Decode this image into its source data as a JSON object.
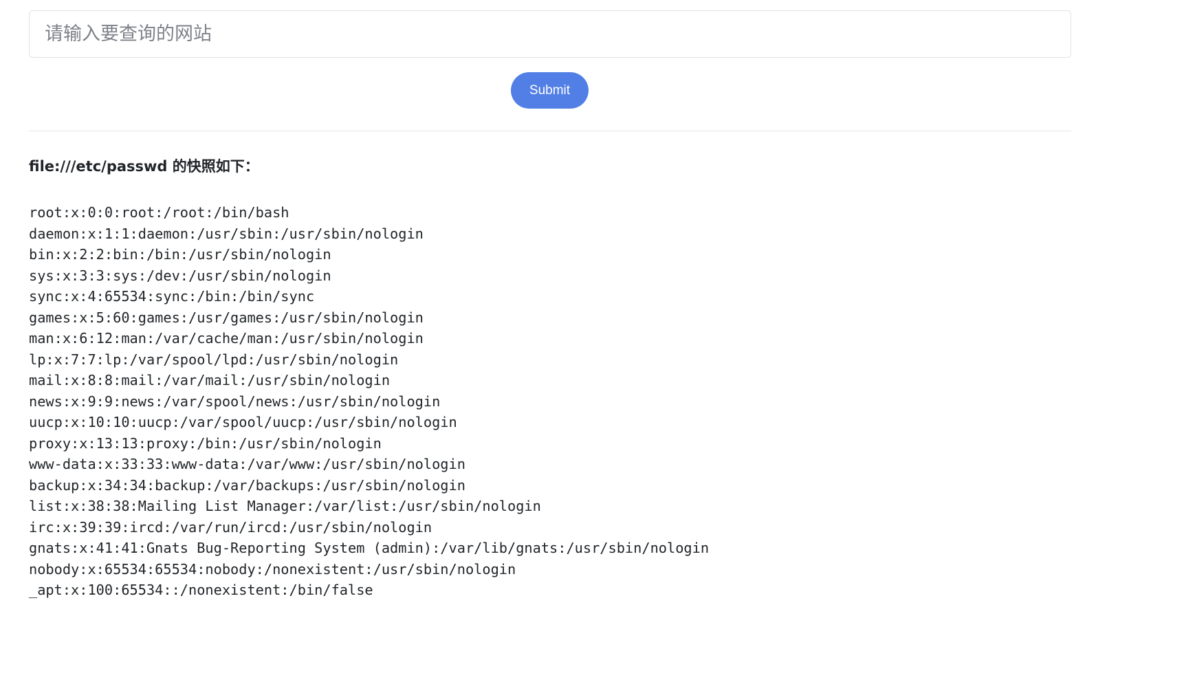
{
  "search": {
    "placeholder": "请输入要查询的网站",
    "value": ""
  },
  "submit_label": "Submit",
  "result": {
    "title": "file:///etc/passwd 的快照如下：",
    "lines": [
      "root:x:0:0:root:/root:/bin/bash",
      "daemon:x:1:1:daemon:/usr/sbin:/usr/sbin/nologin",
      "bin:x:2:2:bin:/bin:/usr/sbin/nologin",
      "sys:x:3:3:sys:/dev:/usr/sbin/nologin",
      "sync:x:4:65534:sync:/bin:/bin/sync",
      "games:x:5:60:games:/usr/games:/usr/sbin/nologin",
      "man:x:6:12:man:/var/cache/man:/usr/sbin/nologin",
      "lp:x:7:7:lp:/var/spool/lpd:/usr/sbin/nologin",
      "mail:x:8:8:mail:/var/mail:/usr/sbin/nologin",
      "news:x:9:9:news:/var/spool/news:/usr/sbin/nologin",
      "uucp:x:10:10:uucp:/var/spool/uucp:/usr/sbin/nologin",
      "proxy:x:13:13:proxy:/bin:/usr/sbin/nologin",
      "www-data:x:33:33:www-data:/var/www:/usr/sbin/nologin",
      "backup:x:34:34:backup:/var/backups:/usr/sbin/nologin",
      "list:x:38:38:Mailing List Manager:/var/list:/usr/sbin/nologin",
      "irc:x:39:39:ircd:/var/run/ircd:/usr/sbin/nologin",
      "gnats:x:41:41:Gnats Bug-Reporting System (admin):/var/lib/gnats:/usr/sbin/nologin",
      "nobody:x:65534:65534:nobody:/nonexistent:/usr/sbin/nologin",
      "_apt:x:100:65534::/nonexistent:/bin/false"
    ]
  },
  "colors": {
    "button_bg": "#527fe6",
    "button_text": "#ffffff",
    "text": "#212529",
    "border": "#dee2e6"
  }
}
